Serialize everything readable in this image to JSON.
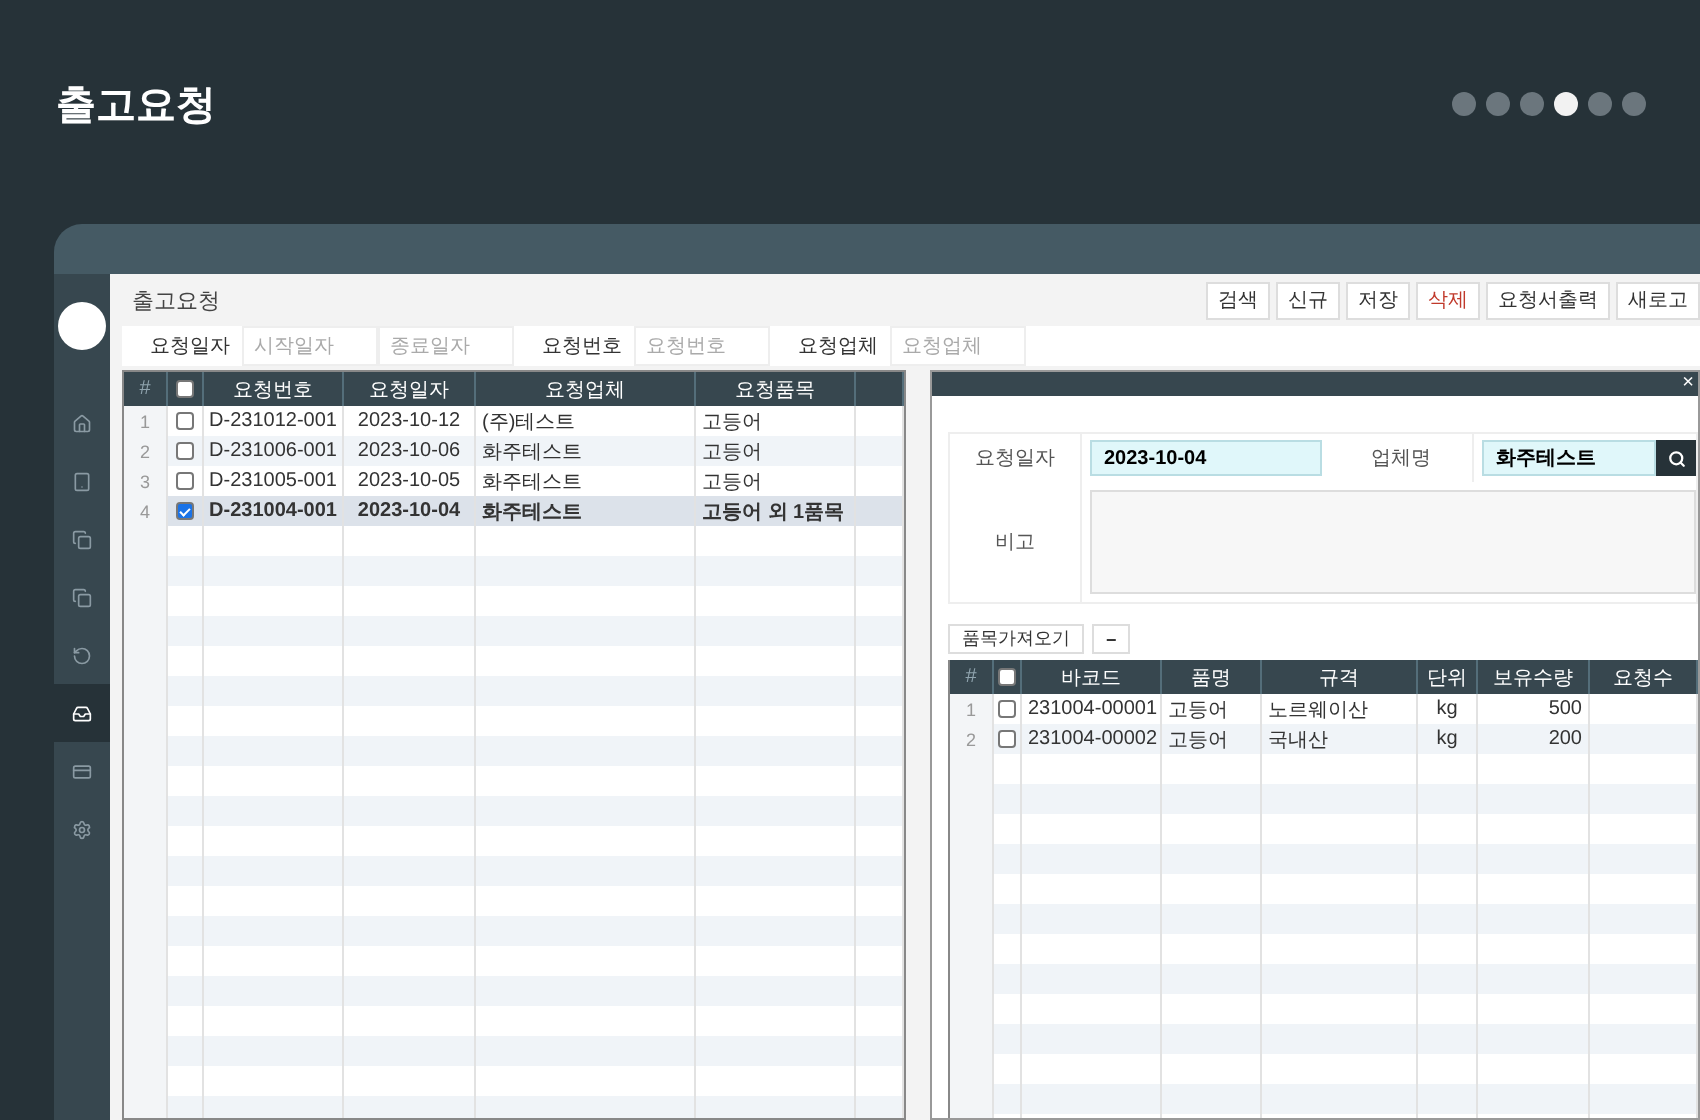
{
  "page_title": "출고요청",
  "pager": [
    {
      "selected": false
    },
    {
      "selected": false
    },
    {
      "selected": false
    },
    {
      "selected": true
    },
    {
      "selected": false
    },
    {
      "selected": false
    }
  ],
  "sidebar": {
    "items": [
      {
        "kind": "home",
        "selected": false
      },
      {
        "kind": "tablet",
        "selected": false
      },
      {
        "kind": "copy",
        "selected": false
      },
      {
        "kind": "copy",
        "selected": false
      },
      {
        "kind": "history",
        "selected": false
      },
      {
        "kind": "inbox",
        "selected": true
      },
      {
        "kind": "card",
        "selected": false
      },
      {
        "kind": "settings",
        "selected": false
      }
    ]
  },
  "window": {
    "title": "출고요청",
    "toolbar": [
      {
        "label": "검색",
        "kind": "normal"
      },
      {
        "label": "신규",
        "kind": "normal"
      },
      {
        "label": "저장",
        "kind": "normal"
      },
      {
        "label": "삭제",
        "kind": "danger"
      },
      {
        "label": "요청서출력",
        "kind": "normal"
      },
      {
        "label": "새로고",
        "kind": "normal"
      }
    ],
    "filters": [
      {
        "label": "요청일자",
        "fields": [
          {
            "placeholder": "시작일자"
          },
          {
            "placeholder": "종료일자"
          }
        ]
      },
      {
        "label": "요청번호",
        "fields": [
          {
            "placeholder": "요청번호"
          }
        ]
      },
      {
        "label": "요청업체",
        "fields": [
          {
            "placeholder": "요청업체"
          }
        ]
      }
    ]
  },
  "list_table": {
    "all_checked": false,
    "columns": [
      "#",
      "",
      "요청번호",
      "요청일자",
      "요청업체",
      "요청품목"
    ],
    "rows": [
      {
        "checked": false,
        "selected": false,
        "cells": [
          "1",
          "",
          "D-231012-001",
          "2023-10-12",
          "(주)테스트",
          "고등어"
        ]
      },
      {
        "checked": false,
        "selected": false,
        "cells": [
          "2",
          "",
          "D-231006-001",
          "2023-10-06",
          "화주테스트",
          "고등어"
        ]
      },
      {
        "checked": false,
        "selected": false,
        "cells": [
          "3",
          "",
          "D-231005-001",
          "2023-10-05",
          "화주테스트",
          "고등어"
        ]
      },
      {
        "checked": true,
        "selected": true,
        "cells": [
          "4",
          "",
          "D-231004-001",
          "2023-10-04",
          "화주테스트",
          "고등어 외 1품목"
        ]
      }
    ]
  },
  "detail": {
    "close": "×",
    "form": {
      "date_label": "요청일자",
      "date_value": "2023-10-04",
      "vendor_label": "업체명",
      "vendor_value": "화주테스트",
      "memo_label": "비고"
    },
    "buttons": [
      {
        "label": "품목가져오기"
      },
      {
        "label": "−"
      }
    ],
    "items_table": {
      "all_checked": false,
      "columns": [
        "#",
        "",
        "바코드",
        "품명",
        "규격",
        "단위",
        "보유수량",
        "요청수"
      ],
      "rows": [
        {
          "checked": false,
          "cells": [
            "1",
            "",
            "231004-00001",
            "고등어",
            "노르웨이산",
            "kg",
            "500"
          ]
        },
        {
          "checked": false,
          "cells": [
            "2",
            "",
            "231004-00002",
            "고등어",
            "국내산",
            "kg",
            "200"
          ]
        }
      ]
    }
  }
}
